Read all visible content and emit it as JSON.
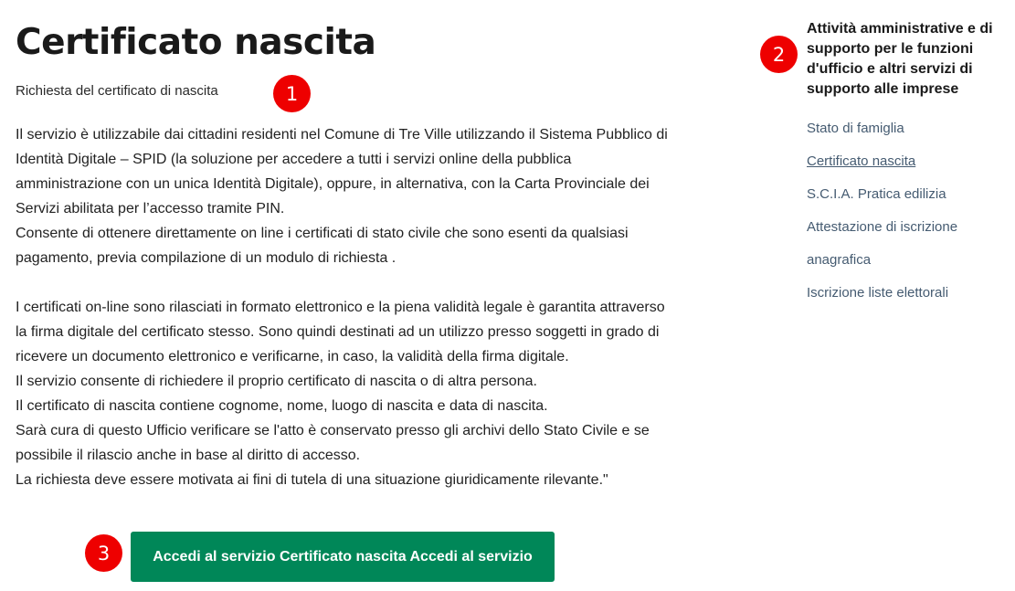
{
  "page": {
    "title": "Certificato nascita",
    "subtitle": "Richiesta del certificato di nascita"
  },
  "body": {
    "paragraphs": [
      "Il servizio è utilizzabile dai cittadini residenti nel Comune di Tre Ville utilizzando il Sistema Pubblico di Identità Digitale – SPID (la soluzione per accedere a tutti i servizi online della pubblica amministrazione con un unica Identità Digitale), oppure, in alternativa, con la Carta Provinciale dei Servizi abilitata per l’accesso tramite PIN.",
      "Consente di ottenere direttamente on line i certificati di stato civile che sono esenti da qualsiasi pagamento, previa compilazione di un modulo di richiesta .",
      "I certificati on-line sono rilasciati in formato elettronico e la piena validità legale è garantita attraverso la firma digitale del certificato stesso. Sono quindi destinati ad un utilizzo presso soggetti in grado di ricevere un documento elettronico e verificarne, in caso, la validità della firma digitale.",
      "Il servizio consente di richiedere il proprio certificato di nascita o di altra persona.",
      "Il certificato di nascita contiene cognome, nome, luogo di nascita e data di nascita.",
      "Sarà cura di questo Ufficio verificare se l'atto è conservato presso gli archivi dello Stato Civile e se possibile il rilascio anche in base al diritto di accesso.",
      "La richiesta deve essere motivata ai fini di tutela di una situazione giuridicamente rilevante.\""
    ]
  },
  "cta": {
    "label": "Accedi al servizio Certificato nascita Accedi al servizio",
    "color": "#008758"
  },
  "sidebar": {
    "heading": "Attività amministrative e di supporto per le funzioni d'ufficio e altri servizi di supporto alle imprese",
    "items": [
      {
        "label": "Stato di famiglia"
      },
      {
        "label": "Certificato nascita",
        "active": true
      },
      {
        "label": "S.C.I.A. Pratica edilizia"
      },
      {
        "label": "Attestazione di iscrizione"
      },
      {
        "label": "anagrafica"
      },
      {
        "label": "Iscrizione liste elettorali"
      }
    ]
  },
  "badges": {
    "one": "1",
    "two": "2",
    "three": "3",
    "color": "#ee0000"
  }
}
